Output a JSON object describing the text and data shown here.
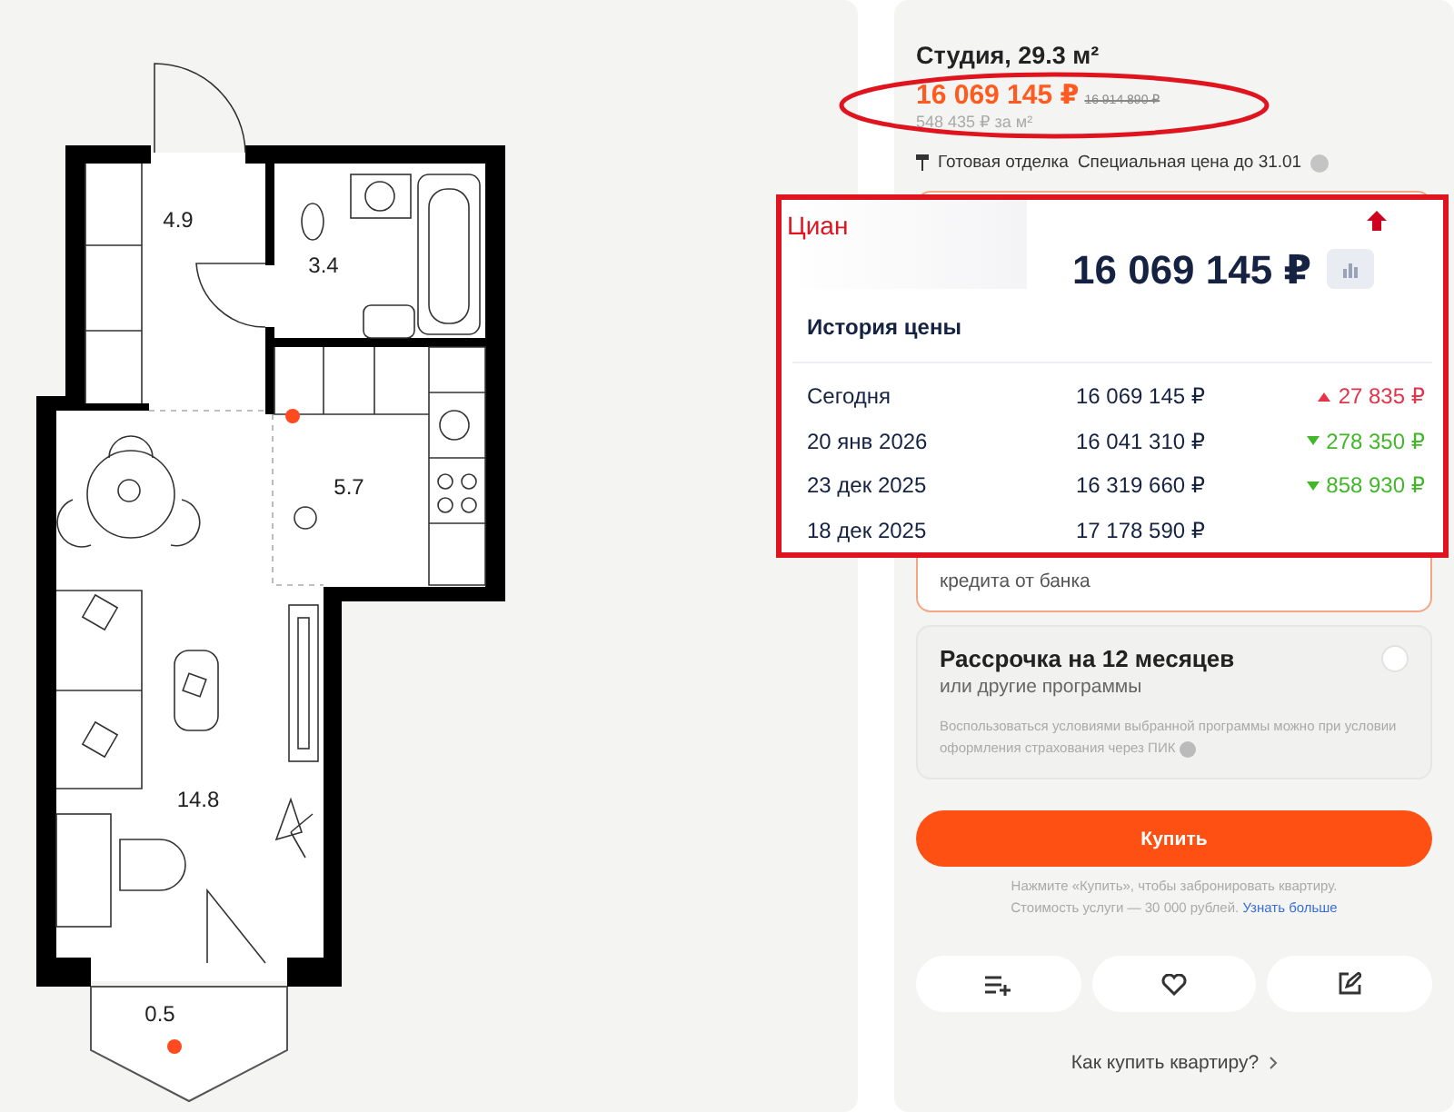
{
  "plan": {
    "rooms": [
      {
        "area": "4.9"
      },
      {
        "area": "3.4"
      },
      {
        "area": "5.7"
      },
      {
        "area": "14.8"
      },
      {
        "area": "0.5"
      }
    ]
  },
  "listing": {
    "title": "Студия, 29.3 м²",
    "price": "16 069 145 ₽",
    "old_price": "16 914 890 ₽",
    "price_per_m2": "548 435 ₽ за м²",
    "tags": [
      {
        "kind": "finish",
        "text": "Готовая отделка"
      },
      {
        "kind": "info",
        "text": "Специальная цена до 31.01"
      }
    ]
  },
  "payment_options": [
    {
      "kind": "partial",
      "text": "кредита от банка",
      "selected": true
    },
    {
      "kind": "full",
      "title": "Рассрочка на 12 месяцев",
      "subtitle": "или другие программы",
      "note": "Воспользоваться условиями выбранной программы можно при условии оформления страхования через ПИК",
      "selected": false
    }
  ],
  "buy_button": "Купить",
  "buy_note": {
    "line_1": "Нажмите «Купить», чтобы забронировать квартиру.",
    "line_2": "Стоимость услуги — 30 000 рублей.",
    "link": "Узнать больше"
  },
  "actions": [
    {
      "kind": "compare"
    },
    {
      "kind": "favorite"
    },
    {
      "kind": "edit"
    }
  ],
  "how_to_buy": "Как купить квартиру?",
  "price_popup": {
    "source": "Циан",
    "current_price": "16 069 145 ₽",
    "price_rising": true,
    "title": "История цены",
    "rows": [
      {
        "date": "Сегодня",
        "price": "16 069 145 ₽",
        "change": "27 835 ₽",
        "rising": true
      },
      {
        "date": "20 янв 2026",
        "price": "16 041 310 ₽",
        "change": "278 350 ₽",
        "rising": false
      },
      {
        "date": "23 дек 2025",
        "price": "16 319 660 ₽",
        "change": "858 930 ₽",
        "rising": false
      },
      {
        "date": "18 дек 2025",
        "price": "17 178 590 ₽"
      }
    ]
  }
}
